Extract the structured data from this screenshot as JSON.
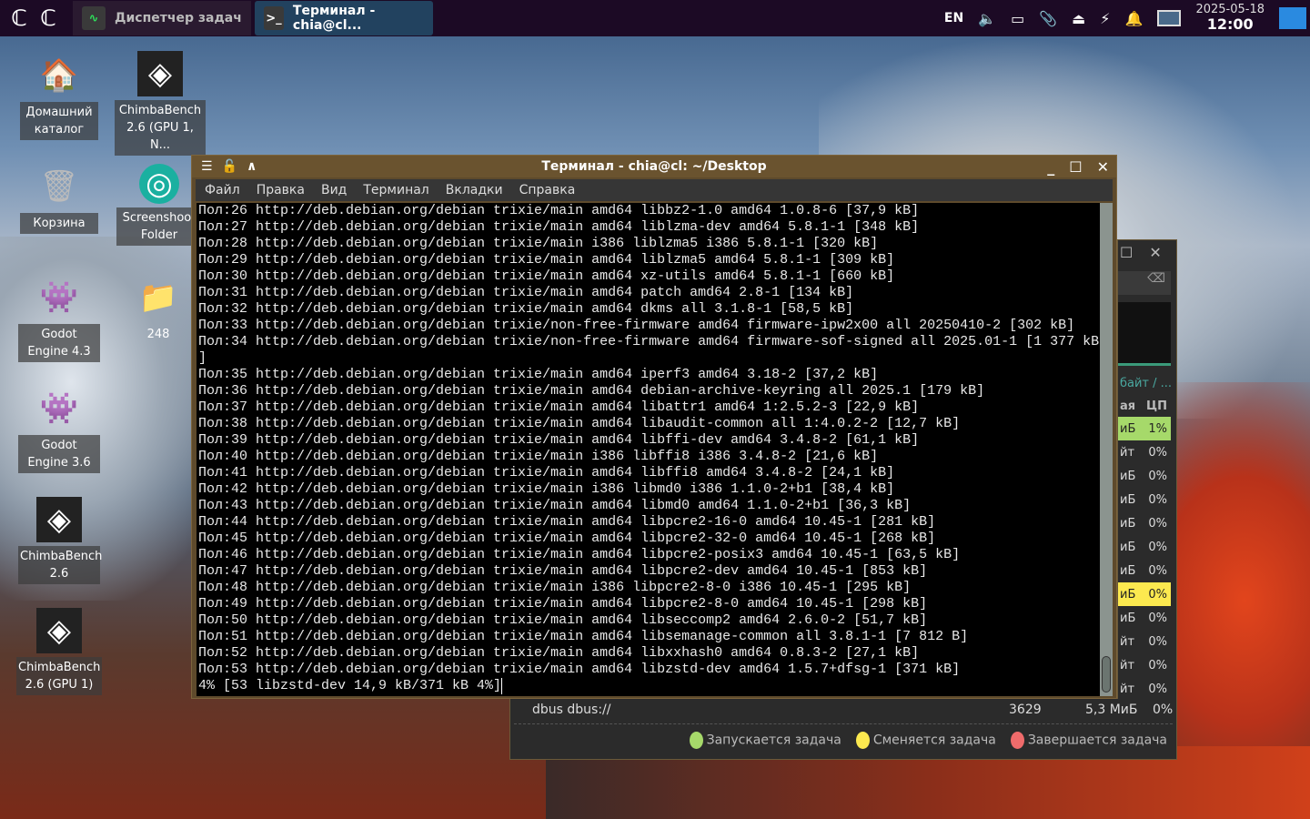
{
  "taskbar": {
    "tasks": [
      {
        "label": "Диспетчер задач",
        "icon": "activity-icon"
      },
      {
        "label": "Терминал - chia@cl...",
        "icon": "terminal-icon"
      }
    ],
    "tray": {
      "lang": "EN",
      "date": "2025-05-18",
      "time": "12:00"
    }
  },
  "desktop": {
    "icons": [
      {
        "label": "Домашний каталог",
        "icon": "home-folder-icon"
      },
      {
        "label": "ChimbaBench 2.6 (GPU 1, N...",
        "icon": "chimbabench-icon"
      },
      {
        "label": "Корзина",
        "icon": "trash-icon"
      },
      {
        "label": "Screenshoot Folder",
        "icon": "screenshot-icon"
      },
      {
        "label": "Godot Engine 4.3",
        "icon": "godot-icon"
      },
      {
        "label": "248",
        "icon": "folder-icon"
      },
      {
        "label": "Godot Engine 3.6",
        "icon": "godot-icon"
      },
      {
        "label": "ChimbaBench 2.6",
        "icon": "chimbabench-icon"
      },
      {
        "label": "ChimbaBench 2.6 (GPU 1)",
        "icon": "chimbabench-icon"
      }
    ]
  },
  "terminal": {
    "title": "Терминал - chia@cl: ~/Desktop",
    "menu": [
      "Файл",
      "Правка",
      "Вид",
      "Терминал",
      "Вкладки",
      "Справка"
    ],
    "lines": [
      "Пол:26 http://deb.debian.org/debian trixie/main amd64 libbz2-1.0 amd64 1.0.8-6 [37,9 kB]",
      "Пол:27 http://deb.debian.org/debian trixie/main amd64 liblzma-dev amd64 5.8.1-1 [348 kB]",
      "Пол:28 http://deb.debian.org/debian trixie/main i386 liblzma5 i386 5.8.1-1 [320 kB]",
      "Пол:29 http://deb.debian.org/debian trixie/main amd64 liblzma5 amd64 5.8.1-1 [309 kB]",
      "Пол:30 http://deb.debian.org/debian trixie/main amd64 xz-utils amd64 5.8.1-1 [660 kB]",
      "Пол:31 http://deb.debian.org/debian trixie/main amd64 patch amd64 2.8-1 [134 kB]",
      "Пол:32 http://deb.debian.org/debian trixie/main amd64 dkms all 3.1.8-1 [58,5 kB]",
      "Пол:33 http://deb.debian.org/debian trixie/non-free-firmware amd64 firmware-ipw2x00 all 20250410-2 [302 kB]",
      "Пол:34 http://deb.debian.org/debian trixie/non-free-firmware amd64 firmware-sof-signed all 2025.01-1 [1 377 kB",
      "]",
      "Пол:35 http://deb.debian.org/debian trixie/main amd64 iperf3 amd64 3.18-2 [37,2 kB]",
      "Пол:36 http://deb.debian.org/debian trixie/main amd64 debian-archive-keyring all 2025.1 [179 kB]",
      "Пол:37 http://deb.debian.org/debian trixie/main amd64 libattr1 amd64 1:2.5.2-3 [22,9 kB]",
      "Пол:38 http://deb.debian.org/debian trixie/main amd64 libaudit-common all 1:4.0.2-2 [12,7 kB]",
      "Пол:39 http://deb.debian.org/debian trixie/main amd64 libffi-dev amd64 3.4.8-2 [61,1 kB]",
      "Пол:40 http://deb.debian.org/debian trixie/main i386 libffi8 i386 3.4.8-2 [21,6 kB]",
      "Пол:41 http://deb.debian.org/debian trixie/main amd64 libffi8 amd64 3.4.8-2 [24,1 kB]",
      "Пол:42 http://deb.debian.org/debian trixie/main i386 libmd0 i386 1.1.0-2+b1 [38,4 kB]",
      "Пол:43 http://deb.debian.org/debian trixie/main amd64 libmd0 amd64 1.1.0-2+b1 [36,3 kB]",
      "Пол:44 http://deb.debian.org/debian trixie/main amd64 libpcre2-16-0 amd64 10.45-1 [281 kB]",
      "Пол:45 http://deb.debian.org/debian trixie/main amd64 libpcre2-32-0 amd64 10.45-1 [268 kB]",
      "Пол:46 http://deb.debian.org/debian trixie/main amd64 libpcre2-posix3 amd64 10.45-1 [63,5 kB]",
      "Пол:47 http://deb.debian.org/debian trixie/main amd64 libpcre2-dev amd64 10.45-1 [853 kB]",
      "Пол:48 http://deb.debian.org/debian trixie/main i386 libpcre2-8-0 i386 10.45-1 [295 kB]",
      "Пол:49 http://deb.debian.org/debian trixie/main amd64 libpcre2-8-0 amd64 10.45-1 [298 kB]",
      "Пол:50 http://deb.debian.org/debian trixie/main amd64 libseccomp2 amd64 2.6.0-2 [51,7 kB]",
      "Пол:51 http://deb.debian.org/debian trixie/main amd64 libsemanage-common all 3.8.1-1 [7 812 B]",
      "Пол:52 http://deb.debian.org/debian trixie/main amd64 libxxhash0 amd64 0.8.3-2 [27,1 kB]",
      "Пол:53 http://deb.debian.org/debian trixie/main amd64 libzstd-dev amd64 1.5.7+dfsg-1 [371 kB]",
      "4% [53 libzstd-dev 14,9 kB/371 kB 4%]"
    ]
  },
  "taskmanager": {
    "col_header_partial": "байт / ...",
    "col_mem_partial": "ая",
    "col_cpu": "ЦП",
    "rows": [
      {
        "mem": "иБ",
        "cpu": "1%",
        "hl": "#a6d96a"
      },
      {
        "mem": "йт",
        "cpu": "0%"
      },
      {
        "mem": "иБ",
        "cpu": "0%"
      },
      {
        "mem": "иБ",
        "cpu": "0%"
      },
      {
        "mem": "иБ",
        "cpu": "0%"
      },
      {
        "mem": "иБ",
        "cpu": "0%"
      },
      {
        "mem": "иБ",
        "cpu": "0%"
      },
      {
        "mem": "иБ",
        "cpu": "0%",
        "hl": "#fce94f"
      },
      {
        "mem": "иБ",
        "cpu": "0%"
      },
      {
        "mem": "йт",
        "cpu": "0%"
      },
      {
        "mem": "йт",
        "cpu": "0%"
      },
      {
        "mem": "йт",
        "cpu": "0%"
      }
    ],
    "last_row": {
      "name": "dbus dbus://",
      "pid": "3629",
      "mem": "5,3 МиБ",
      "cpu": "0%"
    },
    "legend": [
      {
        "label": "Запускается задача",
        "color": "#a6d96a"
      },
      {
        "label": "Сменяется задача",
        "color": "#fce94f"
      },
      {
        "label": "Завершается задача",
        "color": "#ef6b6b"
      }
    ]
  }
}
